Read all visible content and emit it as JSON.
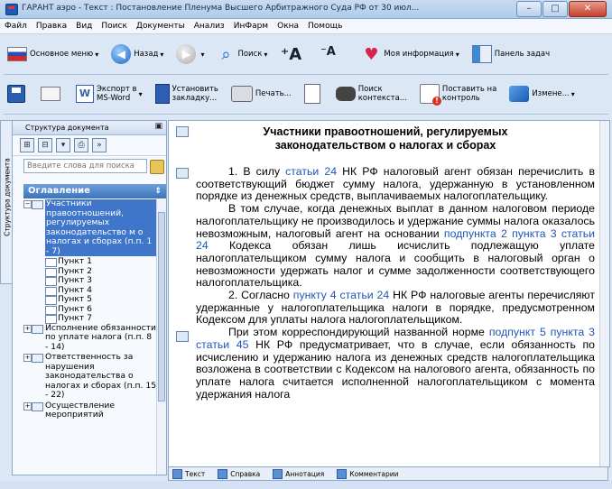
{
  "window": {
    "title": "ГАРАНТ аэро - Текст : Постановление Пленума Высшего Арбитражного Суда РФ от 30 июл..."
  },
  "menu": [
    "Файл",
    "Правка",
    "Вид",
    "Поиск",
    "Документы",
    "Анализ",
    "ИнФарм",
    "Окна",
    "Помощь"
  ],
  "toolbar1": {
    "main_menu": "Основное меню",
    "back": "Назад",
    "search": "Поиск",
    "my_info": "Моя информация",
    "taskbar": "Панель задач"
  },
  "toolbar2": {
    "export_line1": "Экспорт в",
    "export_line2": "MS-Word",
    "bookmark_line1": "Установить",
    "bookmark_line2": "закладку...",
    "print": "Печать...",
    "ctx_line1": "Поиск",
    "ctx_line2": "контекста...",
    "control_line1": "Поставить на",
    "control_line2": "контроль",
    "changes": "Измене..."
  },
  "left_panel": {
    "header": "Структура документа",
    "vertical_tab": "Структура документа",
    "search_placeholder": "Введите слова для поиска",
    "toc_title": "Оглавление",
    "toc": [
      {
        "text": "Участники правоотношений, регулируемых законодательство м о налогах и сборах (п.п. 1 - 7)",
        "selected": true,
        "expanded": true
      },
      {
        "text": "Исполнение обязанности по уплате налога (п.п. 8 - 14)",
        "selected": false,
        "expanded": false
      },
      {
        "text": "Ответственность за нарушения законодательства о налогах и сборах (п.п. 15 - 22)",
        "selected": false,
        "expanded": false
      },
      {
        "text": "Осуществление мероприятий",
        "selected": false,
        "expanded": false
      }
    ],
    "sub_items": [
      "Пункт 1",
      "Пункт 2",
      "Пункт 3",
      "Пункт 4",
      "Пункт 5",
      "Пункт 6",
      "Пункт 7"
    ]
  },
  "document": {
    "title": "Участники правоотношений, регулируемых законодательством о налогах и сборах",
    "p1": {
      "a": "1. В силу ",
      "link1": "статьи 24",
      "b": " НК РФ налоговый агент обязан перечислить в соответствующий бюджет сумму налога, удержанную в установленном порядке из денежных средств, выплачиваемых налогоплательщику."
    },
    "p2": {
      "a": "В том случае, когда денежных выплат в данном налоговом периоде налогоплательщику не производилось и удержание суммы налога оказалось невозможным, налоговый агент на основании ",
      "link1": "подпункта 2 пункта 3 статьи 24",
      "b": " Кодекса обязан лишь исчислить подлежащую уплате налогоплательщиком сумму налога и сообщить в налоговый орган о невозможности удержать налог и сумме задолженности соответствующего налогоплательщика."
    },
    "p3": {
      "a": "2. Согласно ",
      "link1": "пункту 4 статьи 24",
      "b": " НК РФ налоговые агенты перечисляют удержанные у налогоплательщика налоги в порядке, предусмотренном Кодексом для уплаты налога налогоплательщиком."
    },
    "p4": {
      "a": "При этом корреспондирующий названной норме ",
      "link1": "подпункт 5 пункта 3 статьи 45",
      "b": " НК РФ предусматривает, что в случае, если обязанность по исчислению и удержанию налога из денежных средств налогоплательщика возложена в соответствии с Кодексом на налогового агента, обязанность по уплате налога считается исполненной налогоплательщиком с момента удержания налога"
    }
  },
  "bottom_tabs": [
    "Текст",
    "Справка",
    "Аннотация",
    "Комментарии"
  ]
}
